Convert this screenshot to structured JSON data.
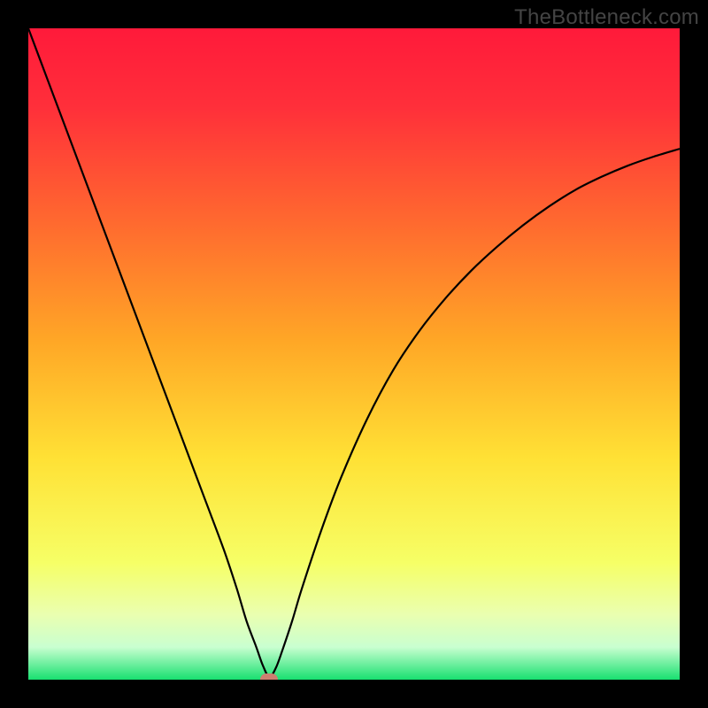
{
  "watermark": "TheBottleneck.com",
  "colors": {
    "frame": "#000000",
    "curve": "#000000",
    "marker": "#cc7f70",
    "gradient_stops": [
      {
        "pct": 0,
        "color": "#ff1a3a"
      },
      {
        "pct": 12,
        "color": "#ff2f3a"
      },
      {
        "pct": 30,
        "color": "#ff6a2f"
      },
      {
        "pct": 48,
        "color": "#ffa726"
      },
      {
        "pct": 66,
        "color": "#ffe135"
      },
      {
        "pct": 82,
        "color": "#f6ff66"
      },
      {
        "pct": 90,
        "color": "#eaffb0"
      },
      {
        "pct": 95,
        "color": "#c9ffd0"
      },
      {
        "pct": 100,
        "color": "#18e070"
      }
    ]
  },
  "chart_data": {
    "type": "line",
    "title": "",
    "xlabel": "",
    "ylabel": "",
    "xlim": [
      0,
      100
    ],
    "ylim": [
      0,
      100
    ],
    "grid": false,
    "legend": false,
    "marker": {
      "x": 37,
      "y": 0
    },
    "series": [
      {
        "name": "curve",
        "x": [
          0,
          3,
          6,
          9,
          12,
          15,
          18,
          21,
          24,
          27,
          30,
          32,
          33.5,
          35,
          36,
          37,
          38,
          39,
          40.5,
          42,
          45,
          48,
          52,
          56,
          60,
          64,
          68,
          72,
          76,
          80,
          84,
          88,
          92,
          96,
          100
        ],
        "y": [
          100,
          92,
          84,
          76,
          68,
          60,
          52,
          44,
          36,
          28,
          20,
          14,
          9,
          5,
          2.2,
          0.4,
          1.8,
          4.5,
          9,
          14,
          23,
          31,
          40,
          47.5,
          53.5,
          58.5,
          62.8,
          66.5,
          69.8,
          72.7,
          75.2,
          77.2,
          78.9,
          80.3,
          81.5
        ]
      }
    ]
  }
}
